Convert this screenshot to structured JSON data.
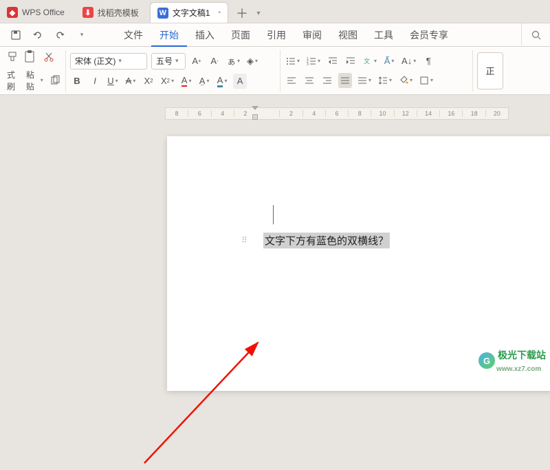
{
  "tabs": {
    "office": "WPS Office",
    "templates": "找稻壳模板",
    "doc": "文字文稿1"
  },
  "qat": {
    "save": "💾",
    "back": "↶",
    "undo": "↷",
    "customize": "▾"
  },
  "menus": {
    "file": "文件",
    "start": "开始",
    "insert": "插入",
    "page": "页面",
    "reference": "引用",
    "review": "审阅",
    "view": "视图",
    "tools": "工具",
    "vip": "会员专享"
  },
  "ribbon": {
    "fmtpainter": "式刷",
    "paste": "粘贴",
    "font": "宋体 (正文)",
    "size": "五号",
    "styles_label": "正"
  },
  "doc": {
    "text": "文字下方有蓝色的双横线？"
  },
  "watermark": {
    "main": "极光下载站",
    "sub": "www.xz7.com",
    "glyph": "G"
  },
  "ruler": {
    "marks": [
      "8",
      "6",
      "4",
      "2",
      "",
      "2",
      "4",
      "6",
      "8",
      "10",
      "12",
      "14",
      "16",
      "18",
      "20"
    ]
  }
}
